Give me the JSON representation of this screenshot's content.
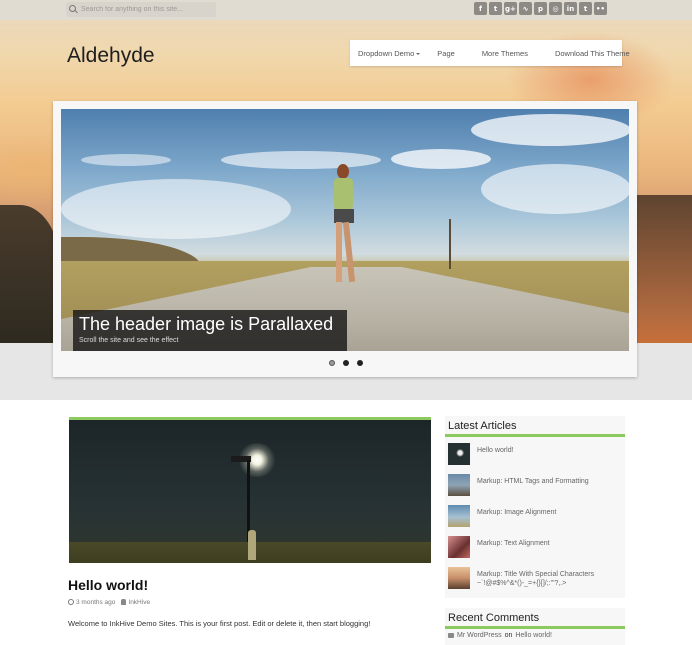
{
  "topbar": {
    "search_placeholder": "Search for anything on this site...",
    "social_icons": [
      {
        "name": "facebook-icon",
        "glyph": "f"
      },
      {
        "name": "twitter-icon",
        "glyph": "t"
      },
      {
        "name": "google-plus-icon",
        "glyph": "g+"
      },
      {
        "name": "rss-icon",
        "glyph": "∿"
      },
      {
        "name": "pinterest-icon",
        "glyph": "p"
      },
      {
        "name": "instagram-icon",
        "glyph": "◎"
      },
      {
        "name": "linkedin-icon",
        "glyph": "in"
      },
      {
        "name": "tumblr-icon",
        "glyph": "t"
      },
      {
        "name": "flickr-icon",
        "glyph": "••"
      }
    ]
  },
  "site": {
    "title": "Aldehyde"
  },
  "nav": {
    "items": [
      {
        "label": "Dropdown Demo",
        "has_dropdown": true
      },
      {
        "label": "Page"
      },
      {
        "label": "More Themes"
      },
      {
        "label": "Download This Theme"
      }
    ]
  },
  "slider": {
    "caption_title": "The header image is Parallaxed",
    "caption_sub": "Scroll the site and see the effect",
    "slide_count": 3,
    "active_slide": 1
  },
  "post": {
    "title": "Hello world!",
    "date": "3 months ago",
    "author": "InkHive",
    "excerpt": "Welcome to InkHive Demo Sites. This is your first post. Edit or delete it, then start blogging!"
  },
  "sidebar": {
    "latest_title": "Latest Articles",
    "articles": [
      {
        "title": "Hello world!"
      },
      {
        "title": "Markup: HTML Tags and Formatting"
      },
      {
        "title": "Markup: Image Alignment"
      },
      {
        "title": "Markup: Text Alignment"
      },
      {
        "title": "Markup: Title With Special Characters ~`!@#$%^&*()-_=+{}[]/;:'\"?,.>"
      }
    ],
    "comments_title": "Recent Comments",
    "comment": {
      "author": "Mr WordPress",
      "on": "on",
      "post": "Hello world!"
    }
  },
  "colors": {
    "accent": "#8cc95f",
    "caption_bg": "#191919"
  }
}
